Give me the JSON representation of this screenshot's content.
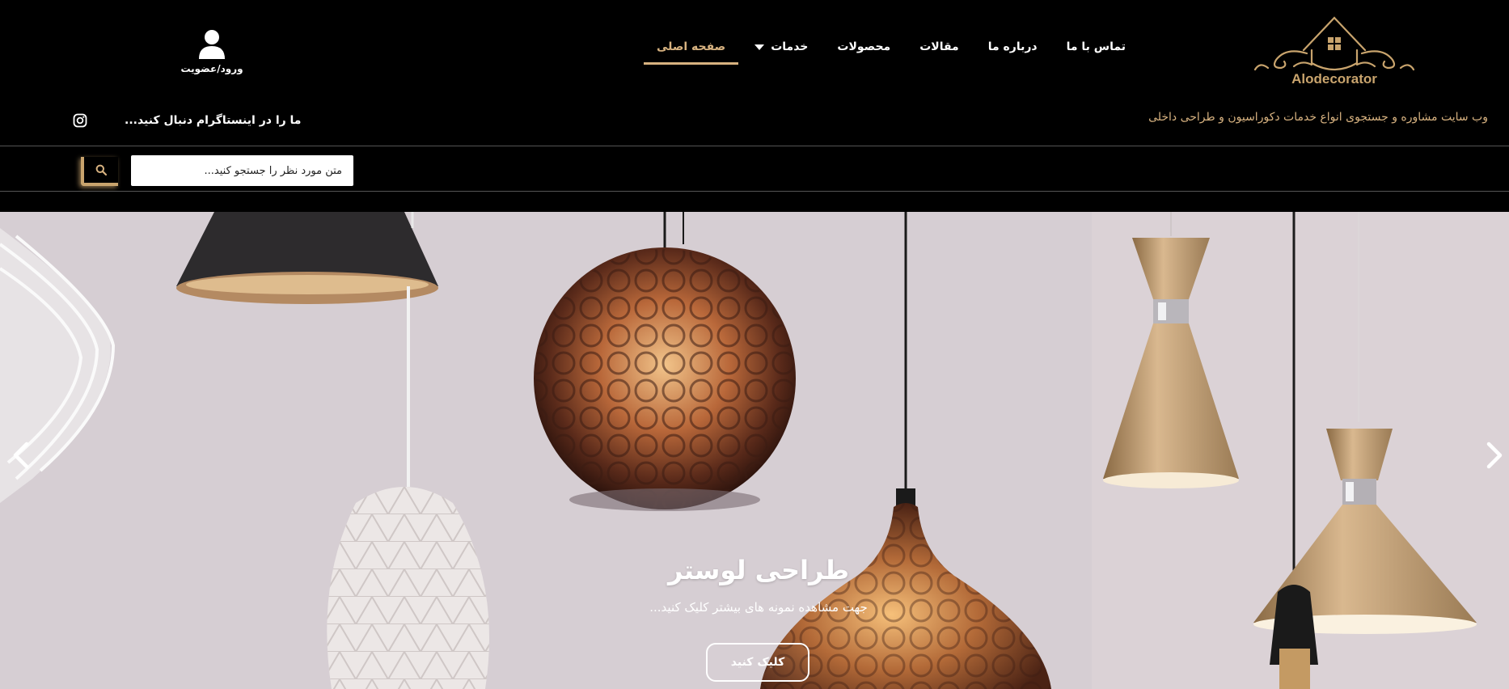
{
  "header": {
    "logo_text": "Alodecorator",
    "nav": [
      {
        "label": "صفحه اصلی",
        "active": true
      },
      {
        "label": "خدمات",
        "has_dropdown": true
      },
      {
        "label": "محصولات"
      },
      {
        "label": "مقالات"
      },
      {
        "label": "درباره ما"
      },
      {
        "label": "تماس با ما"
      }
    ],
    "login_label": "ورود/عضویت",
    "tagline": "وب سایت مشاوره و جستجوی انواع خدمات دکوراسیون و طراحی داخلی",
    "instagram_text": "ما را در اینستاگرام دنبال کنید...",
    "search": {
      "placeholder": "متن مورد نظر را جستجو کنید..."
    }
  },
  "hero": {
    "title": "طراحی لوستر",
    "subtitle": "جهت مشاهده نمونه های بیشتر کلیک کنید...",
    "button_label": "کلیک کنید"
  },
  "colors": {
    "accent": "#d7b280",
    "background": "#000000"
  },
  "icons": [
    "user-icon",
    "instagram-icon",
    "search-icon",
    "chevron-left-icon",
    "chevron-right-icon",
    "caret-down-icon"
  ]
}
